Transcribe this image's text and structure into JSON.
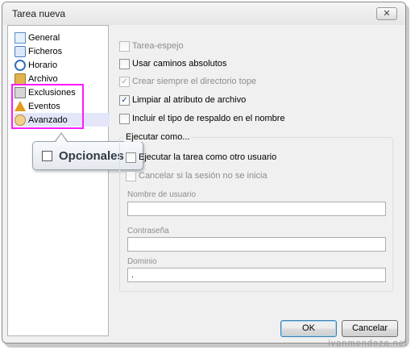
{
  "window": {
    "title": "Tarea nueva",
    "close_symbol": "✕"
  },
  "sidebar": {
    "items": [
      {
        "label": "General",
        "icon": "general-icon"
      },
      {
        "label": "Ficheros",
        "icon": "files-icon"
      },
      {
        "label": "Horario",
        "icon": "clock-icon"
      },
      {
        "label": "Archivo",
        "icon": "archive-icon"
      },
      {
        "label": "Exclusiones",
        "icon": "exclusions-icon"
      },
      {
        "label": "Eventos",
        "icon": "events-bell-icon"
      },
      {
        "label": "Avanzado",
        "icon": "advanced-user-icon",
        "selected": true
      }
    ]
  },
  "callout": {
    "label": "Opcionales"
  },
  "options": [
    {
      "label": "Tarea-espejo",
      "checked": false,
      "disabled": true
    },
    {
      "label": "Usar caminos absolutos",
      "checked": false,
      "disabled": false
    },
    {
      "label": "Crear siempre el directorio tope",
      "checked": true,
      "disabled": true
    },
    {
      "label": "Limpiar al atributo de archivo",
      "checked": true,
      "disabled": false
    },
    {
      "label": "Incluir el tipo de respaldo en el nombre",
      "checked": false,
      "disabled": false
    }
  ],
  "run_as": {
    "group_title": "Ejecutar como...",
    "run_other_user": {
      "label": "Ejecutar la tarea como otro usuario",
      "checked": false
    },
    "cancel_on_logoff": {
      "label": "Cancelar si la sesión no se inicia",
      "checked": false
    },
    "username": {
      "label": "Nombre de usuario",
      "value": ""
    },
    "password": {
      "label": "Contraseña",
      "value": ""
    },
    "domain": {
      "label": "Dominio",
      "value": "."
    }
  },
  "buttons": {
    "ok": "OK",
    "cancel": "Cancelar"
  },
  "watermark": "ivanmendoza.net",
  "colors": {
    "highlight": "#ff1aff",
    "selected_bg": "#e3e5f8"
  }
}
